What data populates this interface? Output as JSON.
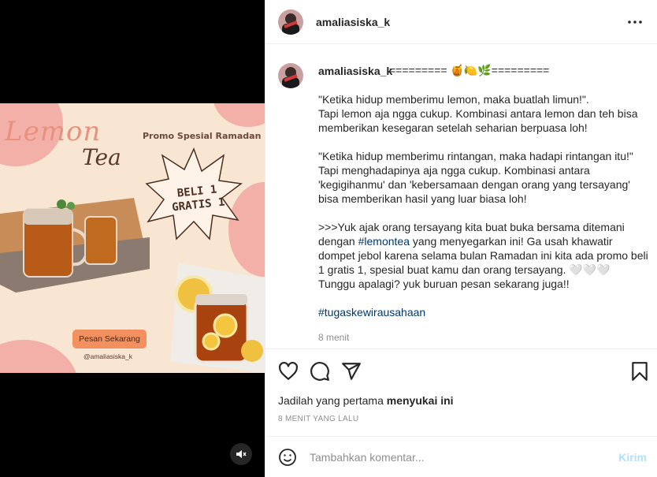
{
  "media": {
    "poster_title_1": "Lemon",
    "poster_title_2": "Tea",
    "promo_label": "Promo Spesial Ramadan",
    "burst_line_1": "BELI 1",
    "burst_line_2": "GRATIS 1",
    "order_button": "Pesan Sekarang",
    "handle": "@amaliasiska_k",
    "mute_icon": "speaker-muted-icon"
  },
  "header": {
    "username": "amaliasiska_k",
    "more_icon": "more-horizontal-icon"
  },
  "caption": {
    "username": "amaliasiska_k",
    "heading": "========= 🍯🍋🌿=========",
    "paragraphs": [
      "\"Ketika hidup memberimu lemon, maka buatlah limun!\".\nTapi lemon aja ngga cukup. Kombinasi antara lemon dan teh bisa memberikan kesegaran setelah seharian berpuasa loh!",
      "\"Ketika hidup memberimu rintangan, maka hadapi rintangan itu!\"\nTapi menghadapinya aja ngga cukup. Kombinasi antara 'kegigihanmu' dan 'kebersamaan dengan orang yang tersayang' bisa memberikan hasil yang luar biasa loh!"
    ],
    "promo_part1": ">>>Yuk ajak orang tersayang kita buat buka bersama ditemani dengan ",
    "promo_hashtag": "#lemontea",
    "promo_part2": " yang menyegarkan ini! Ga usah khawatir dompet jebol karena selama bulan Ramadan ini kita ada promo beli 1 gratis 1, spesial buat kamu dan orang tersayang. 🤍🤍🤍\nTunggu apalagi? yuk buruan pesan sekarang juga!!",
    "hashtag": "#tugaskewirausahaan",
    "time": "8 menit"
  },
  "actions": {
    "like_icon": "heart-icon",
    "comment_icon": "comment-icon",
    "share_icon": "paper-plane-icon",
    "save_icon": "bookmark-icon"
  },
  "likes": {
    "prefix": "Jadilah yang pertama ",
    "bold": "menyukai ini"
  },
  "timestamp": "8 MENIT YANG LALU",
  "comment": {
    "emoji_icon": "smiley-icon",
    "placeholder": "Tambahkan komentar...",
    "post_label": "Kirim"
  },
  "colors": {
    "link": "#00376b",
    "post_disabled": "#b2dffc",
    "poster_bg": "#f8e6d2",
    "order_button": "#f2915f"
  }
}
